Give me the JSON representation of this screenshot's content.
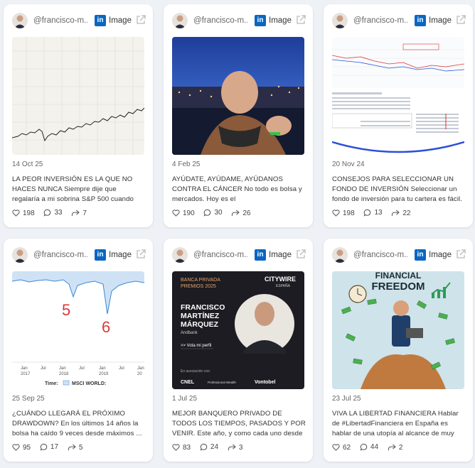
{
  "posts": [
    {
      "author": "@francisco-m...",
      "platform": "in",
      "kind": "Image",
      "date": "14 Oct 25",
      "text": "LA PEOR INVERSIÓN ES LA QUE NO HACES NUNCA Siempre dije que regalaría a mi sobrina S&P 500 cuando naciera. Para...",
      "likes": "198",
      "comments": "33",
      "shares": "7"
    },
    {
      "author": "@francisco-m...",
      "platform": "in",
      "kind": "Image",
      "date": "4 Feb 25",
      "text": "AYÚDATE, AYÚDAME, AYÚDANOS CONTRA EL CÁNCER No todo es bolsa y mercados. Hoy es el #DíaMundialContraelCáncer y...",
      "likes": "190",
      "comments": "30",
      "shares": "26"
    },
    {
      "author": "@francisco-m...",
      "platform": "in",
      "kind": "Image",
      "date": "20 Nov 24",
      "text": "CONSEJOS PARA SELECCIONAR UN FONDO DE INVERSIÓN Seleccionar un fondo de inversión para tu cartera es fácil. Elegir el...",
      "likes": "198",
      "comments": "13",
      "shares": "22"
    },
    {
      "author": "@francisco-m...",
      "platform": "in",
      "kind": "Image",
      "date": "25 Sep 25",
      "text": "¿CUÁNDO LLEGARÁ EL PRÓXIMO DRAWDOWN? En los últimos 14 años la bolsa ha caído 9 veces desde máximos ...",
      "likes": "95",
      "comments": "17",
      "shares": "5",
      "image": {
        "mark_left": "5",
        "mark_right": "6",
        "x_labels": [
          "Jan\n2017",
          "Jul",
          "Jan\n2018",
          "Jul",
          "Jan\n2019",
          "Jul",
          "Jan\n20"
        ],
        "legend": "Time:",
        "legend_series": "MSCI WORLD:"
      }
    },
    {
      "author": "@francisco-m...",
      "platform": "in",
      "kind": "Image",
      "date": "1 Jul 25",
      "text": "MEJOR BANQUERO PRIVADO DE TODOS LOS TIEMPOS, PASADOS Y POR VENIR. Este año, y como cada uno desde hace cuatro,...",
      "likes": "83",
      "comments": "24",
      "shares": "3",
      "image": {
        "title_line1": "BANCA PRIVADA",
        "title_line2": "PREMIOS 2025",
        "brand": "CITYWIRE",
        "brand_sub": "ESPAÑA",
        "name1": "FRANCISCO",
        "name2": "MARTÍNEZ",
        "name3": "MÁRQUEZ",
        "company": "Andbank",
        "vote": ">> Vota mi perfil",
        "partners_label": "En asociación con:",
        "partner1": "CNEL",
        "partner2": "Professional Wealth",
        "partner3": "Vontobel"
      }
    },
    {
      "author": "@francisco-m...",
      "platform": "in",
      "kind": "Image",
      "date": "23 Jul 25",
      "text": "VIVA LA LIBERTAD FINANCIERA Hablar de #LibertadFinanciera en España es hablar de una utopía al alcance de muy pocos...",
      "likes": "62",
      "comments": "44",
      "shares": "2",
      "image": {
        "headline1": "FINANCIAL",
        "headline2": "FREEDOM"
      }
    }
  ],
  "colors": {
    "linkedin": "#0a66c2",
    "page_bg": "#eef1f5"
  }
}
